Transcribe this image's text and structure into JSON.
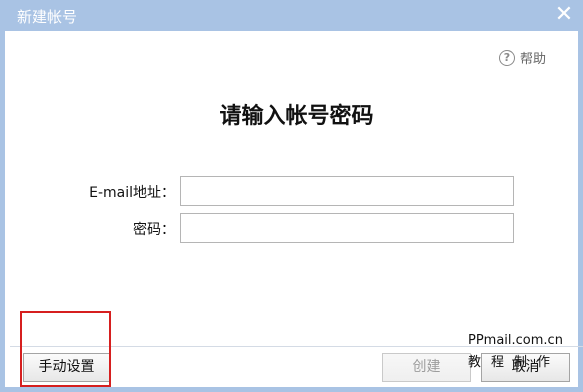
{
  "window": {
    "title": "新建帐号",
    "close_glyph": "✕"
  },
  "help": {
    "icon": "question-circle-icon",
    "label": "帮助"
  },
  "heading": "请输入帐号密码",
  "form": {
    "email_label": "E-mail地址：",
    "email_value": "",
    "password_label": "密码：",
    "password_value": ""
  },
  "buttons": {
    "manual": "手动设置",
    "create": "创建",
    "cancel": "取消"
  },
  "watermark": {
    "line1": "PPmail.com.cn",
    "line2": "教程制作"
  },
  "colors": {
    "titlebar": "#a9c3e4",
    "highlight": "#d61f1f"
  }
}
